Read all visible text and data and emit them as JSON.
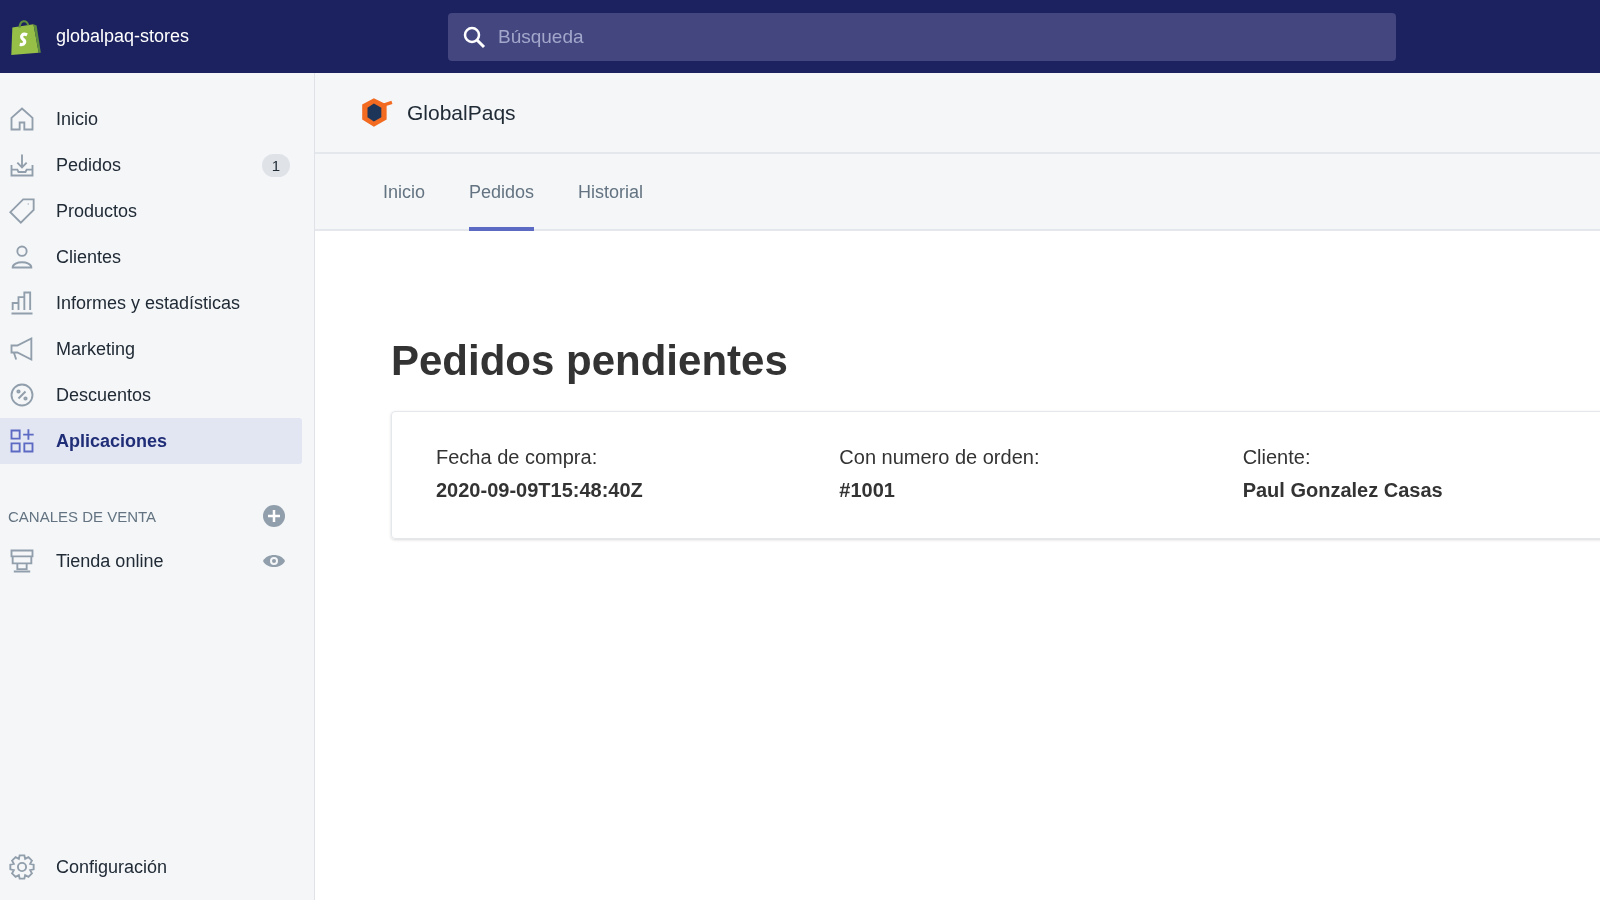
{
  "topbar": {
    "store_name": "globalpaq-stores",
    "search": {
      "placeholder": "Búsqueda"
    }
  },
  "sidebar": {
    "items": [
      {
        "label": "Inicio",
        "selected": false
      },
      {
        "label": "Pedidos",
        "selected": false,
        "badge": "1"
      },
      {
        "label": "Productos",
        "selected": false
      },
      {
        "label": "Clientes",
        "selected": false
      },
      {
        "label": "Informes y estadísticas",
        "selected": false
      },
      {
        "label": "Marketing",
        "selected": false
      },
      {
        "label": "Descuentos",
        "selected": false
      },
      {
        "label": "Aplicaciones",
        "selected": true
      }
    ],
    "channels_heading": "CANALES DE VENTA",
    "channels": [
      {
        "label": "Tienda online"
      }
    ],
    "settings": {
      "label": "Configuración"
    }
  },
  "app": {
    "name": "GlobalPaqs",
    "tabs": [
      {
        "label": "Inicio",
        "selected": false
      },
      {
        "label": "Pedidos",
        "selected": true
      },
      {
        "label": "Historial",
        "selected": false
      }
    ],
    "heading": "Pedidos pendientes",
    "order": {
      "fields": [
        {
          "label": "Fecha de compra:",
          "value": "2020-09-09T15:48:40Z"
        },
        {
          "label": "Con numero de orden:",
          "value": "#1001"
        },
        {
          "label": "Cliente:",
          "value": "Paul Gonzalez Casas"
        }
      ]
    }
  }
}
